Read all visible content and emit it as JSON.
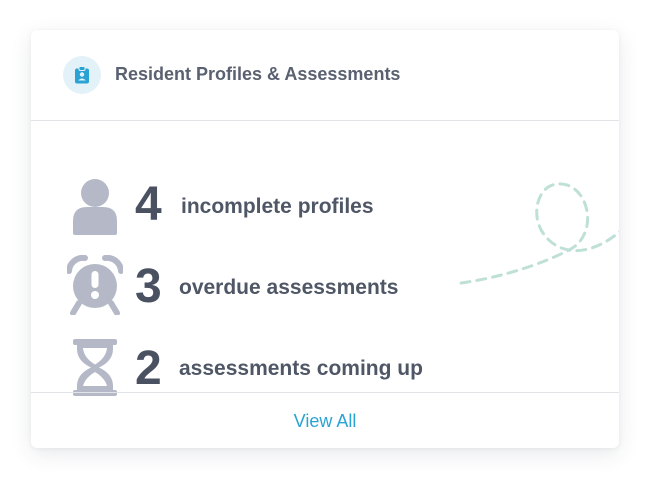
{
  "header": {
    "icon": "clipboard-badge-icon",
    "title": "Resident Profiles & Assessments"
  },
  "stats": [
    {
      "icon": "person-icon",
      "number": "4",
      "label": "incomplete profiles"
    },
    {
      "icon": "alarm-clock-icon",
      "number": "3",
      "label": "overdue assessments"
    },
    {
      "icon": "hourglass-icon",
      "number": "2",
      "label": "assessments coming up"
    }
  ],
  "footer": {
    "view_all_label": "View All"
  },
  "colors": {
    "accent": "#2aa3d4",
    "icon_gray": "#b5b9c7",
    "number_color": "#4a5262",
    "decoration_mint": "#bfe0d6"
  }
}
